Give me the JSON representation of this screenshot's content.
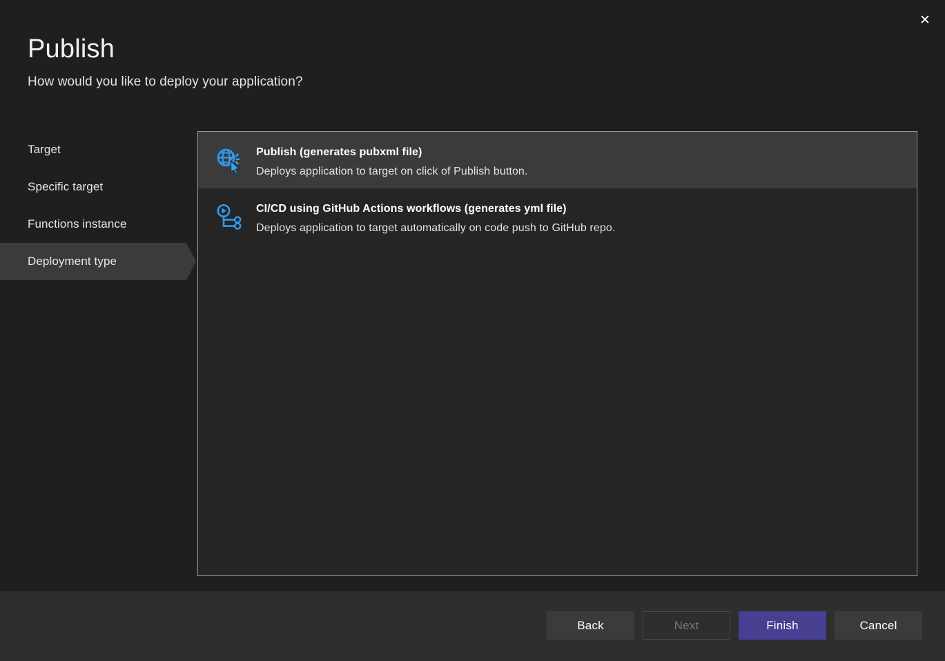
{
  "window": {
    "close_label": "✕"
  },
  "header": {
    "title": "Publish",
    "subtitle": "How would you like to deploy your application?"
  },
  "sidebar": {
    "items": [
      {
        "label": "Target",
        "selected": false
      },
      {
        "label": "Specific target",
        "selected": false
      },
      {
        "label": "Functions instance",
        "selected": false
      },
      {
        "label": "Deployment type",
        "selected": true
      }
    ]
  },
  "main": {
    "options": [
      {
        "icon": "globe-click-icon",
        "title": "Publish (generates pubxml file)",
        "description": "Deploys application to target on click of Publish button.",
        "selected": true
      },
      {
        "icon": "pipeline-workflow-icon",
        "title": "CI/CD using GitHub Actions workflows (generates yml file)",
        "description": "Deploys application to target automatically on code push to GitHub repo.",
        "selected": false
      }
    ]
  },
  "footer": {
    "back_label": "Back",
    "next_label": "Next",
    "finish_label": "Finish",
    "cancel_label": "Cancel"
  },
  "colors": {
    "accent": "#473f91",
    "icon_blue": "#2f9bf0",
    "background": "#1f1f1f",
    "panel": "#252526",
    "selection": "#3b3b3b",
    "footer": "#2e2e2e"
  }
}
